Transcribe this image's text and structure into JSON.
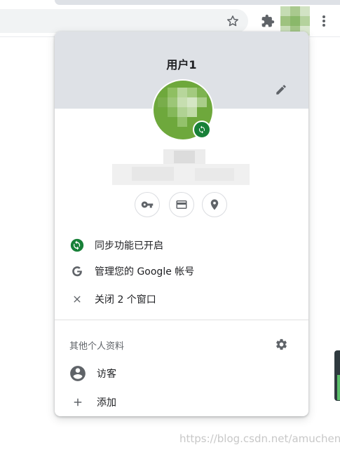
{
  "popup": {
    "profile_name": "用户1",
    "sync_status": "同步功能已开启",
    "manage_account": "管理您的 Google 帐号",
    "close_windows": "关闭 2 个窗口",
    "other_profiles_label": "其他个人资料",
    "guest_label": "访客",
    "add_label": "添加"
  },
  "icons": {
    "toolbar": [
      "star-icon",
      "puzzle-icon",
      "avatar",
      "more-vert-icon"
    ],
    "quick_actions": [
      "key-icon",
      "credit-card-icon",
      "location-pin-icon"
    ]
  },
  "colors": {
    "header_bg": "#dee1e6",
    "sync_green": "#188038",
    "icon_gray": "#5f6368"
  },
  "watermark": "https://blog.csdn.net/amuchena"
}
